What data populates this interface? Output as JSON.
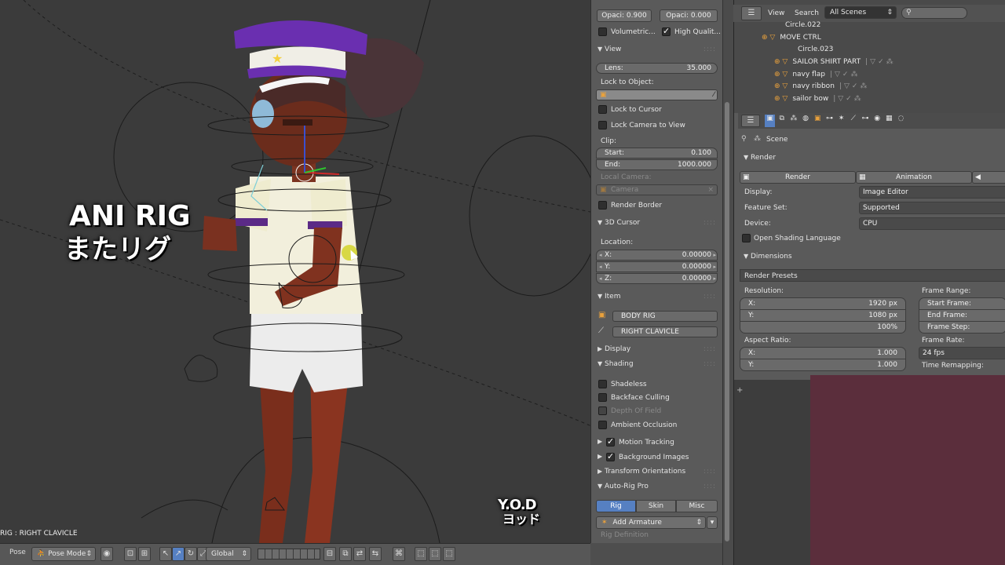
{
  "overlay": {
    "title_line1": "ANI RIG",
    "title_line2": "またリグ",
    "logo_line1": "Y.O.D",
    "logo_line2": "ヨッド"
  },
  "viewport": {
    "status": "RIG : RIGHT CLAVICLE",
    "header": {
      "view_label": "Pose",
      "mode": "Pose Mode",
      "orientation": "Global"
    }
  },
  "npanel": {
    "opacity_left": "Opaci: 0.900",
    "opacity_right": "Opaci: 0.000",
    "volumetric": "Volumetric...",
    "high_quality": "High Qualit...",
    "view": {
      "title": "View",
      "lens_label": "Lens:",
      "lens_value": "35.000",
      "lock_to_object": "Lock to Object:",
      "lock_to_cursor": "Lock to Cursor",
      "lock_camera_to_view": "Lock Camera to View",
      "clip": "Clip:",
      "start_label": "Start:",
      "start_value": "0.100",
      "end_label": "End:",
      "end_value": "1000.000",
      "local_camera": "Local Camera:",
      "camera": "Camera",
      "render_border": "Render Border"
    },
    "cursor": {
      "title": "3D Cursor",
      "location": "Location:",
      "x_label": "X:",
      "x_value": "0.00000",
      "y_label": "Y:",
      "y_value": "0.00000",
      "z_label": "Z:",
      "z_value": "0.00000"
    },
    "item": {
      "title": "Item",
      "object": "BODY RIG",
      "bone": "RIGHT CLAVICLE"
    },
    "display": {
      "title": "Display"
    },
    "shading": {
      "title": "Shading",
      "shadeless": "Shadeless",
      "backface_culling": "Backface Culling",
      "depth_of_field": "Depth Of Field",
      "ambient_occlusion": "Ambient Occlusion"
    },
    "motion_tracking": "Motion Tracking",
    "background_images": "Background Images",
    "transform_orientations": "Transform Orientations",
    "auto_rig_pro": {
      "title": "Auto-Rig Pro",
      "tabs": [
        "Rig",
        "Skin",
        "Misc"
      ],
      "add_armature": "Add Armature",
      "rig_definition": "Rig Definition"
    }
  },
  "outliner": {
    "view": "View",
    "search": "Search",
    "scenes": "All Scenes",
    "rows": [
      {
        "name": "Circle.022"
      },
      {
        "name": "MOVE CTRL"
      },
      {
        "name": "Circle.023"
      },
      {
        "name": "SAILOR SHIRT PART"
      },
      {
        "name": "navy flap"
      },
      {
        "name": "navy ribbon"
      },
      {
        "name": "sailor bow"
      }
    ]
  },
  "properties": {
    "scene": "Scene",
    "render_panel": "Render",
    "render_btn": "Render",
    "animation_btn": "Animation",
    "display_label": "Display:",
    "display_value": "Image Editor",
    "feature_set_label": "Feature Set:",
    "feature_set_value": "Supported",
    "device_label": "Device:",
    "device_value": "CPU",
    "osl": "Open Shading Language",
    "dimensions": "Dimensions",
    "render_presets": "Render Presets",
    "resolution": "Resolution:",
    "res_x_label": "X:",
    "res_x_value": "1920 px",
    "res_y_label": "Y:",
    "res_y_value": "1080 px",
    "res_pct": "100%",
    "aspect": "Aspect Ratio:",
    "asp_x_label": "X:",
    "asp_x_value": "1.000",
    "asp_y_label": "Y:",
    "asp_y_value": "1.000",
    "frame_range": "Frame Range:",
    "start_frame": "Start Frame:",
    "end_frame": "End Frame:",
    "frame_step": "Frame Step:",
    "frame_rate": "Frame Rate:",
    "fps": "24 fps",
    "time_remapping": "Time Remapping:"
  }
}
